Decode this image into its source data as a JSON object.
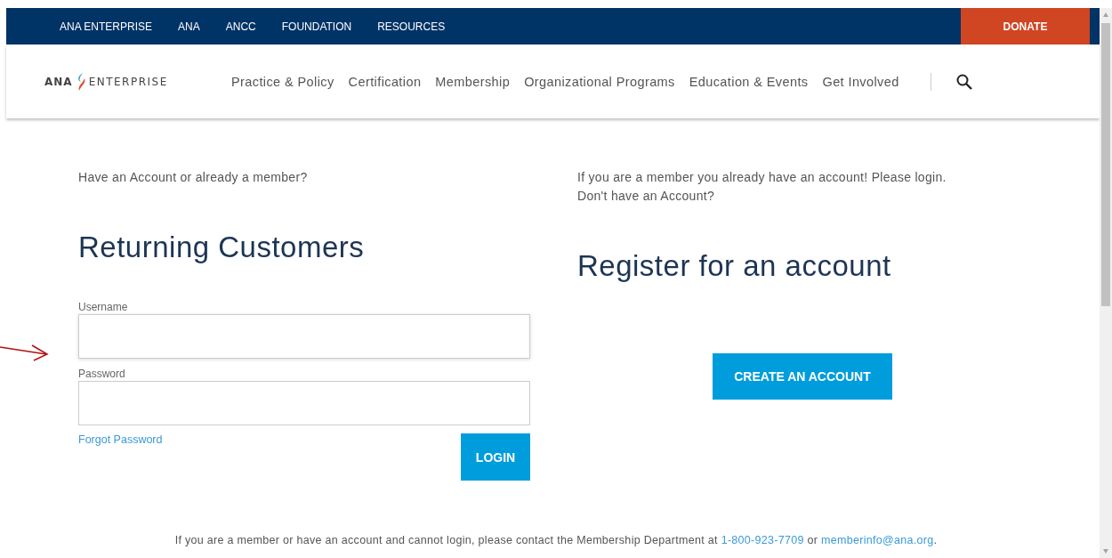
{
  "utility_nav": {
    "items": [
      "ANA ENTERPRISE",
      "ANA",
      "ANCC",
      "FOUNDATION",
      "RESOURCES"
    ],
    "donate": "DONATE"
  },
  "header": {
    "logo": {
      "left": "ANA",
      "right": "ENTERPRISE"
    },
    "nav": [
      "Practice & Policy",
      "Certification",
      "Membership",
      "Organizational Programs",
      "Education & Events",
      "Get Involved"
    ]
  },
  "login": {
    "intro": "Have an Account or already a member?",
    "heading": "Returning Customers",
    "username_label": "Username",
    "password_label": "Password",
    "forgot": "Forgot Password",
    "button": "LOGIN"
  },
  "register": {
    "intro": [
      "If you are a member you already have an account! Please login.",
      "Don't have an Account?"
    ],
    "heading": "Register for an account",
    "button": "CREATE AN ACCOUNT"
  },
  "footer": {
    "text": "If you are a member or have an account and cannot login, please contact the Membership Department at",
    "phone": "1-800-923-7709",
    "joiner": "or",
    "email": "memberinfo@ana.org",
    "end": "."
  }
}
